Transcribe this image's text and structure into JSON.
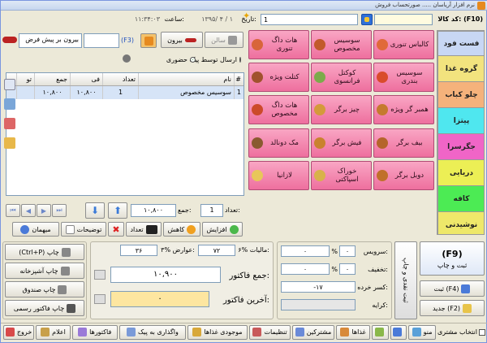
{
  "window": {
    "title": "نرم افزار آریاسان ..... صورتحساب فروش"
  },
  "header": {
    "code_label": "کد کالا: (F10)",
    "code_value": "",
    "qty_value": "1",
    "date_label": "تاریخ:",
    "date_value": "۱۳۹۵/ ۴ / ۱",
    "time_label": "ساعت:",
    "time_value": "۱۱:۳۴:۰۳",
    "prev_btn": "سالن",
    "out_btn": "بیرون",
    "f3_label": "(F3)",
    "order_type_value": "بیرون بر پیش فرض",
    "radio_present": "حضوری",
    "radio_courier": "ارسال توسط پیک"
  },
  "categories": [
    {
      "label": "فست فود",
      "color": "#c8d7f4"
    },
    {
      "label": "گروه غذا",
      "color": "#f2e37e"
    },
    {
      "label": "چلو کباب",
      "color": "#f5b27b"
    },
    {
      "label": "پیتزا",
      "color": "#4fe7ef"
    },
    {
      "label": "جگرسرا",
      "color": "#f065c7"
    },
    {
      "label": "دریایی",
      "color": "#ecef55"
    },
    {
      "label": "کافه",
      "color": "#4ceb54"
    },
    {
      "label": "نوشیدنی",
      "color": "#eee86a"
    }
  ],
  "foods": [
    [
      "کالباس تنوری",
      "سوسیس مخصوص",
      "هات داگ تنوری"
    ],
    [
      "سوسیس بندری",
      "کوکتل فرانسوی",
      "کتلت ویژه"
    ],
    [
      "همبر گر ویژه",
      "چیز برگر",
      "هات داگ مخصوص"
    ],
    [
      "بیف برگر",
      "فیش برگر",
      "مک دونالد"
    ],
    [
      "دوبل برگر",
      "خوراک اسپاکتی",
      "لازانیا"
    ]
  ],
  "food_icon_colors": [
    [
      "#e06a3a",
      "#c25a2a",
      "#d8653a"
    ],
    [
      "#d94c2b",
      "#7bab4a",
      "#a0522d"
    ],
    [
      "#c57a2e",
      "#d49a3a",
      "#cc4a2a"
    ],
    [
      "#b5652b",
      "#c9822e",
      "#8a5a30"
    ],
    [
      "#c0702a",
      "#d8b24a",
      "#e8c75a"
    ]
  ],
  "table": {
    "columns": [
      "#",
      "نام",
      "تعداد",
      "فی",
      "جمع",
      "تو"
    ],
    "rows": [
      [
        "1",
        "سوسیس مخصوص",
        "1",
        "۱۰,۸۰۰",
        "۱۰,۸۰۰",
        ""
      ]
    ]
  },
  "controls": {
    "count_label": "تعداد:",
    "count_value": "1",
    "sum_label": "جمع:",
    "sum_value": "۱۰,۸۰۰",
    "increase": "افزایش",
    "decrease": "کاهش",
    "qty_btn": "تعداد",
    "notes": "توضیحات",
    "guest": "میهمان"
  },
  "summary": {
    "service_label": "سرویس:",
    "service_value": "۰",
    "service_pct": "۰",
    "discount_label": "تخفیف:",
    "discount_value": "۰",
    "discount_pct": "۰",
    "change_label": "کسر خرده:",
    "change_value": "-۱۷",
    "fare_label": "کرایه:",
    "fare_value": "",
    "vat_label": "۶% مالیات:",
    "vat_value": "۷۲",
    "toll_label": "۳% عوارض:",
    "toll_value": "۳۶",
    "total_label": "جمع فاکتور:",
    "total_value": "۱۰,۹۰۰",
    "last_label": "آخرین فاکتور:",
    "last_value": "۰"
  },
  "actions": {
    "f9": "(F9)",
    "f9_sub": "ثبت و چاپ",
    "save_cash": "ثبت نقدی و چاپ",
    "save": "ثبت (F4)",
    "new": "جدید (F2)",
    "print": "(Ctrl+P) چاپ",
    "print_kitchen": "چاپ آشپزخانه",
    "print_cash": "چاپ صندوق",
    "print_official": "چاپ فاکتور رسمی"
  },
  "bottom": {
    "select_customer": "انتخاب مشتری",
    "buttons": [
      "منو",
      "",
      "",
      "غذاها",
      "مشترکین",
      "تنظیمات",
      "موجودی غذاها",
      "واگذاری به پیک",
      "فاکتورها",
      "اعلام",
      "خروج"
    ]
  }
}
